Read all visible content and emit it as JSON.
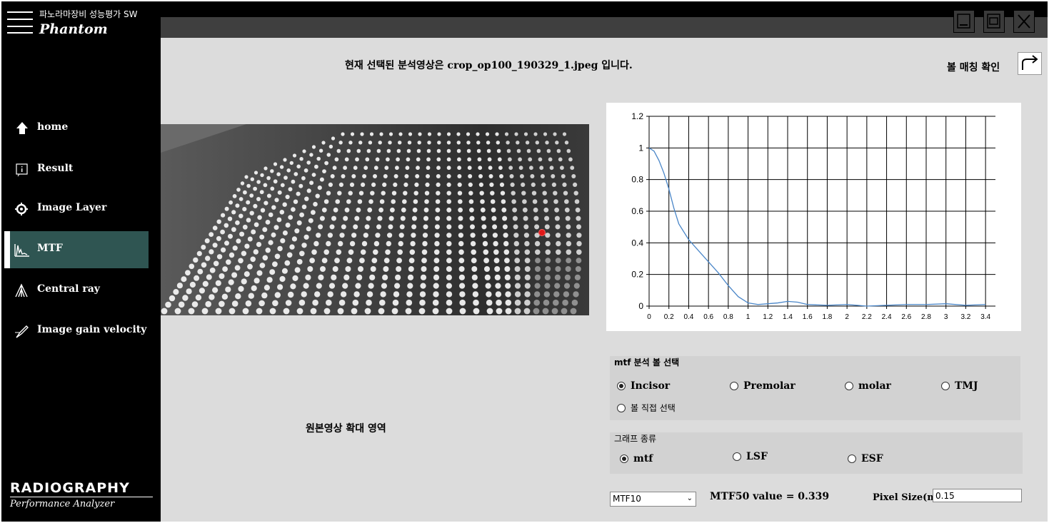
{
  "sidebar": {
    "brand_korean": "파노라마장비 성능평가 SW",
    "brand_name": "Phantom",
    "items": [
      {
        "label": "home",
        "icon": "home-icon"
      },
      {
        "label": "Result",
        "icon": "info-icon"
      },
      {
        "label": "Image Layer",
        "icon": "crosshair-icon"
      },
      {
        "label": "MTF",
        "icon": "waveform-icon",
        "active": true
      },
      {
        "label": "Central ray",
        "icon": "rays-icon"
      },
      {
        "label": "Image gain velocity",
        "icon": "pen-icon"
      }
    ],
    "logo_main": "RADIOGRAPHY",
    "logo_sub": "Performance Analyzer"
  },
  "header": {
    "caption": "현재 선택된 분석영상은 crop_op100_190329_1.jpeg 입니다.",
    "ball_check_label": "볼 매칭 확인"
  },
  "image_panel": {
    "zoom_label": "원본영상 확대 영역"
  },
  "chart_data": {
    "type": "line",
    "x": [
      0,
      0.05,
      0.1,
      0.15,
      0.2,
      0.25,
      0.3,
      0.4,
      0.5,
      0.6,
      0.7,
      0.8,
      0.9,
      1.0,
      1.1,
      1.2,
      1.3,
      1.4,
      1.5,
      1.6,
      1.8,
      2.0,
      2.2,
      2.4,
      2.6,
      2.8,
      3.0,
      3.2,
      3.4
    ],
    "series": [
      {
        "values": [
          1.0,
          0.98,
          0.92,
          0.84,
          0.74,
          0.62,
          0.52,
          0.42,
          0.35,
          0.28,
          0.21,
          0.13,
          0.06,
          0.02,
          0.01,
          0.015,
          0.02,
          0.03,
          0.025,
          0.01,
          0.005,
          0.01,
          0.0,
          0.005,
          0.01,
          0.01,
          0.015,
          0.005,
          0.01
        ],
        "color": "#4a86c8"
      }
    ],
    "xlim": [
      0,
      3.5
    ],
    "ylim": [
      0,
      1.2
    ],
    "xticks": [
      "0",
      "0.2",
      "0.4",
      "0.6",
      "0.8",
      "1",
      "1.2",
      "1.4",
      "1.6",
      "1.8",
      "2",
      "2.2",
      "2.4",
      "2.6",
      "2.8",
      "3",
      "3.2",
      "3.4"
    ],
    "yticks": [
      "0",
      "0.2",
      "0.4",
      "0.6",
      "0.8",
      "1",
      "1.2"
    ],
    "grid": true
  },
  "ball_group": {
    "title": "mtf 분석 볼 선택",
    "options": [
      "Incisor",
      "Premolar",
      "molar",
      "TMJ",
      "볼 직접 선택"
    ],
    "selected": "Incisor"
  },
  "graph_group": {
    "title": "그래프 종류",
    "options": [
      "mtf",
      "LSF",
      "ESF"
    ],
    "selected": "mtf"
  },
  "bottom": {
    "select_value": "MTF10",
    "mtf50_text": "MTF50 value = 0.339",
    "pixel_label": "Pixel Size(mm)",
    "pixel_value": "0.15"
  }
}
